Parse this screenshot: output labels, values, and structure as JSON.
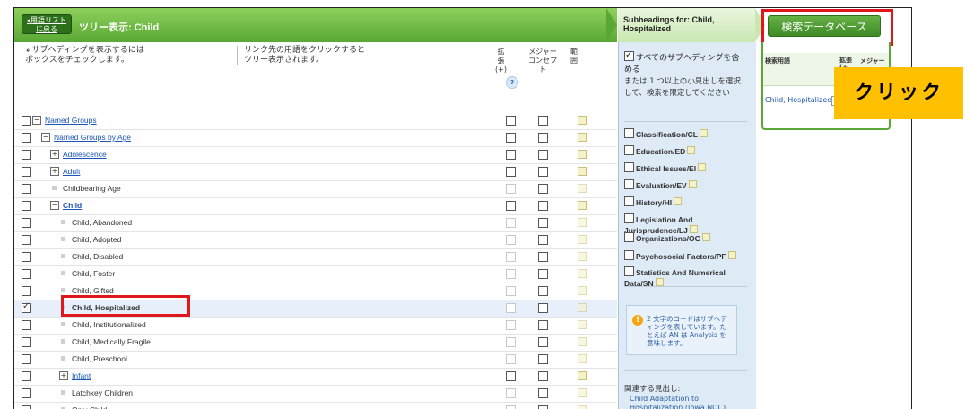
{
  "header": {
    "back_button": "用語リスト\nに戻る",
    "tree_title": "ツリー表示: Child"
  },
  "subheadings_header": "Subheadings for: Child, Hospitalized",
  "instructions": {
    "left": "サブヘディングを表示するには\nボックスをチェックします。",
    "right": "リンク先の用語をクリックすると\nツリー表示されます。"
  },
  "columns": {
    "expand": "拡張 (+)",
    "major": "メジャー\nコンセプ\nト",
    "scope": "範囲",
    "help": "?"
  },
  "tree": [
    {
      "label": "Named Groups",
      "level": 0,
      "type": "link",
      "expander": "minus",
      "checked": false,
      "dim": false
    },
    {
      "label": "Named Groups by Age",
      "level": 1,
      "type": "link",
      "expander": "minus",
      "checked": false,
      "dim": false
    },
    {
      "label": "Adolescence",
      "level": 2,
      "type": "link",
      "expander": "plus",
      "checked": false,
      "dim": false
    },
    {
      "label": "Adult",
      "level": 2,
      "type": "link",
      "expander": "plus",
      "checked": false,
      "dim": false
    },
    {
      "label": "Childbearing Age",
      "level": 2,
      "type": "text",
      "expander": "bullet",
      "checked": false,
      "dim": true
    },
    {
      "label": "Child",
      "level": 2,
      "type": "link-bold",
      "expander": "minus",
      "checked": false,
      "dim": false
    },
    {
      "label": "Child, Abandoned",
      "level": 3,
      "type": "text",
      "expander": "bullet",
      "checked": false,
      "dim": true
    },
    {
      "label": "Child, Adopted",
      "level": 3,
      "type": "text",
      "expander": "bullet",
      "checked": false,
      "dim": true
    },
    {
      "label": "Child, Disabled",
      "level": 3,
      "type": "text",
      "expander": "bullet",
      "checked": false,
      "dim": true
    },
    {
      "label": "Child, Foster",
      "level": 3,
      "type": "text",
      "expander": "bullet",
      "checked": false,
      "dim": true
    },
    {
      "label": "Child, Gifted",
      "level": 3,
      "type": "text",
      "expander": "bullet",
      "checked": false,
      "dim": true
    },
    {
      "label": "Child, Hospitalized",
      "level": 3,
      "type": "bold",
      "expander": "bullet",
      "checked": true,
      "dim": true,
      "selected": true
    },
    {
      "label": "Child, Institutionalized",
      "level": 3,
      "type": "text",
      "expander": "bullet",
      "checked": false,
      "dim": true
    },
    {
      "label": "Child, Medically Fragile",
      "level": 3,
      "type": "text",
      "expander": "bullet",
      "checked": false,
      "dim": true
    },
    {
      "label": "Child, Preschool",
      "level": 3,
      "type": "text",
      "expander": "bullet",
      "checked": false,
      "dim": true
    },
    {
      "label": "Infant",
      "level": 3,
      "type": "link",
      "expander": "plus",
      "checked": false,
      "dim": false
    },
    {
      "label": "Latchkey Children",
      "level": 3,
      "type": "text",
      "expander": "bullet",
      "checked": false,
      "dim": true
    },
    {
      "label": "Only Child",
      "level": 3,
      "type": "text",
      "expander": "bullet",
      "checked": false,
      "dim": true
    }
  ],
  "subheadings": {
    "all_label": "すべてのサブヘディングを含める",
    "all_desc": "または 1 つ以上の小見出しを選択して、検索を限定してください",
    "items": [
      "Classification/CL",
      "Education/ED",
      "Ethical Issues/EI",
      "Evaluation/EV",
      "History/HI",
      "Legislation And Jurisprudence/LJ",
      "Organizations/OG",
      "Psychosocial Factors/PF",
      "Statistics And Numerical Data/SN"
    ],
    "tip": "2 文字のコードはサブヘディングを表しています。たとえば AN は Analysis を意味します。",
    "related_title": "関連する見出し:",
    "related_link": "Child Adaptation to Hospitalization (Iowa NOC)"
  },
  "right_panel": {
    "search_button": "検索データベース",
    "col_term": "検索用語",
    "col_expand": "拡張\n(+",
    "col_major": "メジャー",
    "term": "Child, Hospitalized"
  },
  "callout": "クリック",
  "colors": {
    "green_dark": "#3d8a27",
    "green_light": "#8ed05c",
    "highlight_red": "#e0161d",
    "callout_yellow": "#ffc000",
    "link_blue": "#1a55b7"
  }
}
